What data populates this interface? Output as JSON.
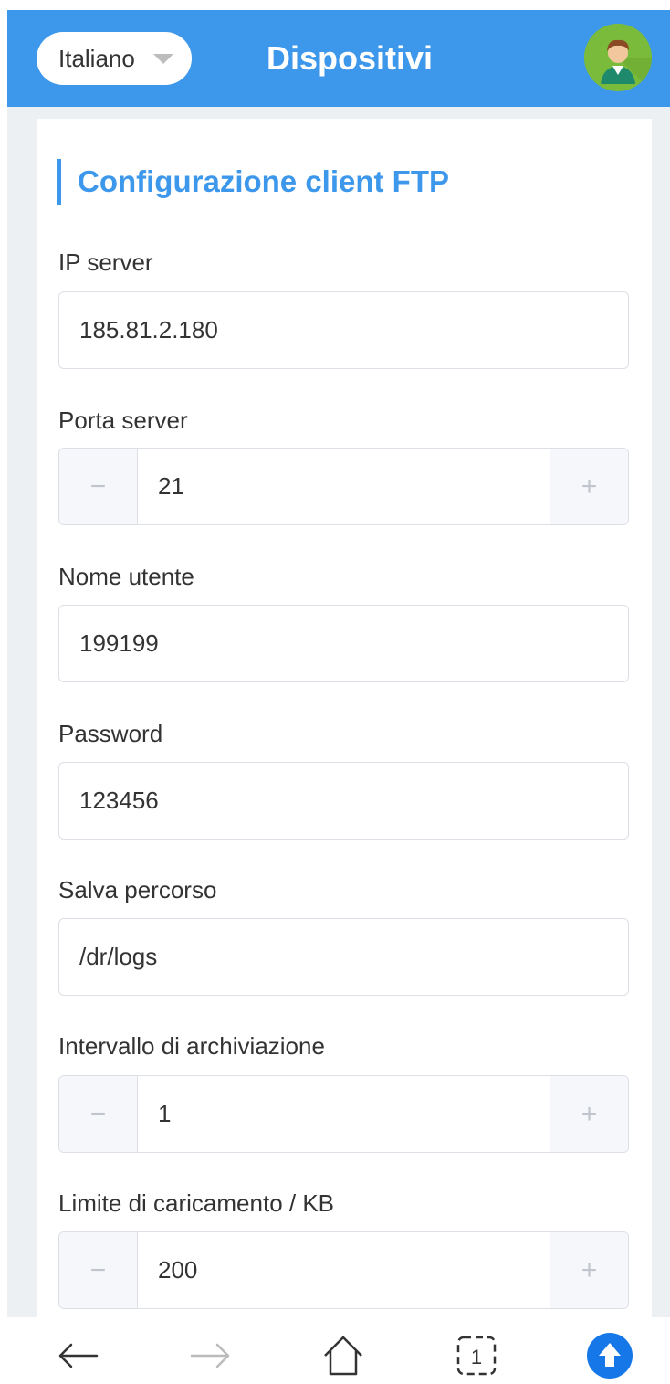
{
  "header": {
    "language": "Italiano",
    "title": "Dispositivi"
  },
  "section_title": "Configurazione client FTP",
  "fields": {
    "ip_server": {
      "label": "IP server",
      "value": "185.81.2.180"
    },
    "porta_server": {
      "label": "Porta server",
      "value": "21"
    },
    "nome_utente": {
      "label": "Nome utente",
      "value": "199199"
    },
    "password": {
      "label": "Password",
      "value": "123456"
    },
    "salva_percorso": {
      "label": "Salva percorso",
      "value": "/dr/logs"
    },
    "intervallo": {
      "label": "Intervallo di archiviazione",
      "value": "1"
    },
    "limite": {
      "label": "Limite di caricamento / KB",
      "value": "200"
    }
  },
  "stepper": {
    "minus": "−",
    "plus": "+"
  },
  "bottom_nav": {
    "tabs_count": "1",
    "icons": [
      "back-arrow-icon",
      "forward-arrow-icon",
      "home-icon",
      "tabs-icon",
      "upload-icon"
    ]
  },
  "colors": {
    "accent": "#3d98eb",
    "avatar_bg": "#7bbb3b",
    "border": "#dcdfe6",
    "text": "#333333"
  }
}
